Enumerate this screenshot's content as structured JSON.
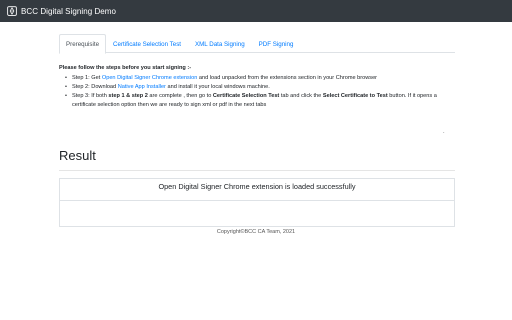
{
  "app": {
    "title": "BCC Digital Signing Demo",
    "icon": "pen-nib-icon"
  },
  "tabs": [
    {
      "label": "Prerequisite",
      "active": true
    },
    {
      "label": "Certificate Selection Test",
      "active": false
    },
    {
      "label": "XML Data Signing",
      "active": false
    },
    {
      "label": "PDF Signing",
      "active": false
    }
  ],
  "instructions": {
    "intro": "Please follow the steps before you start signing :-",
    "step1": {
      "prefix": "Step 1: Get ",
      "link": "Open Digital Signer Chrome extension",
      "suffix": " and load unpacked from the extensions section in your Chrome browser"
    },
    "step2": {
      "prefix": "Step 2: Download ",
      "link": "Native App Installer",
      "suffix": " and install it your local windows machine."
    },
    "step3": {
      "a": "Step 3: If both ",
      "b": "step 1 & step 2",
      "c": " are complete , then go to ",
      "d": "Certificate Selection Test",
      "e": " tab and click the ",
      "f": "Select Certificate to Test",
      "g": " button. If it opens a certificate selection option then we are ready to sign xml or pdf in the next tabs"
    },
    "tick": "·"
  },
  "result": {
    "title": "Result",
    "message": "Open Digital Signer Chrome extension is loaded successfully",
    "detail": ""
  },
  "footer": {
    "text": "Copyright©BCC CA Team, 2021"
  },
  "colors": {
    "navbar": "#343a40",
    "link": "#007bff",
    "border": "#dee2e6"
  }
}
